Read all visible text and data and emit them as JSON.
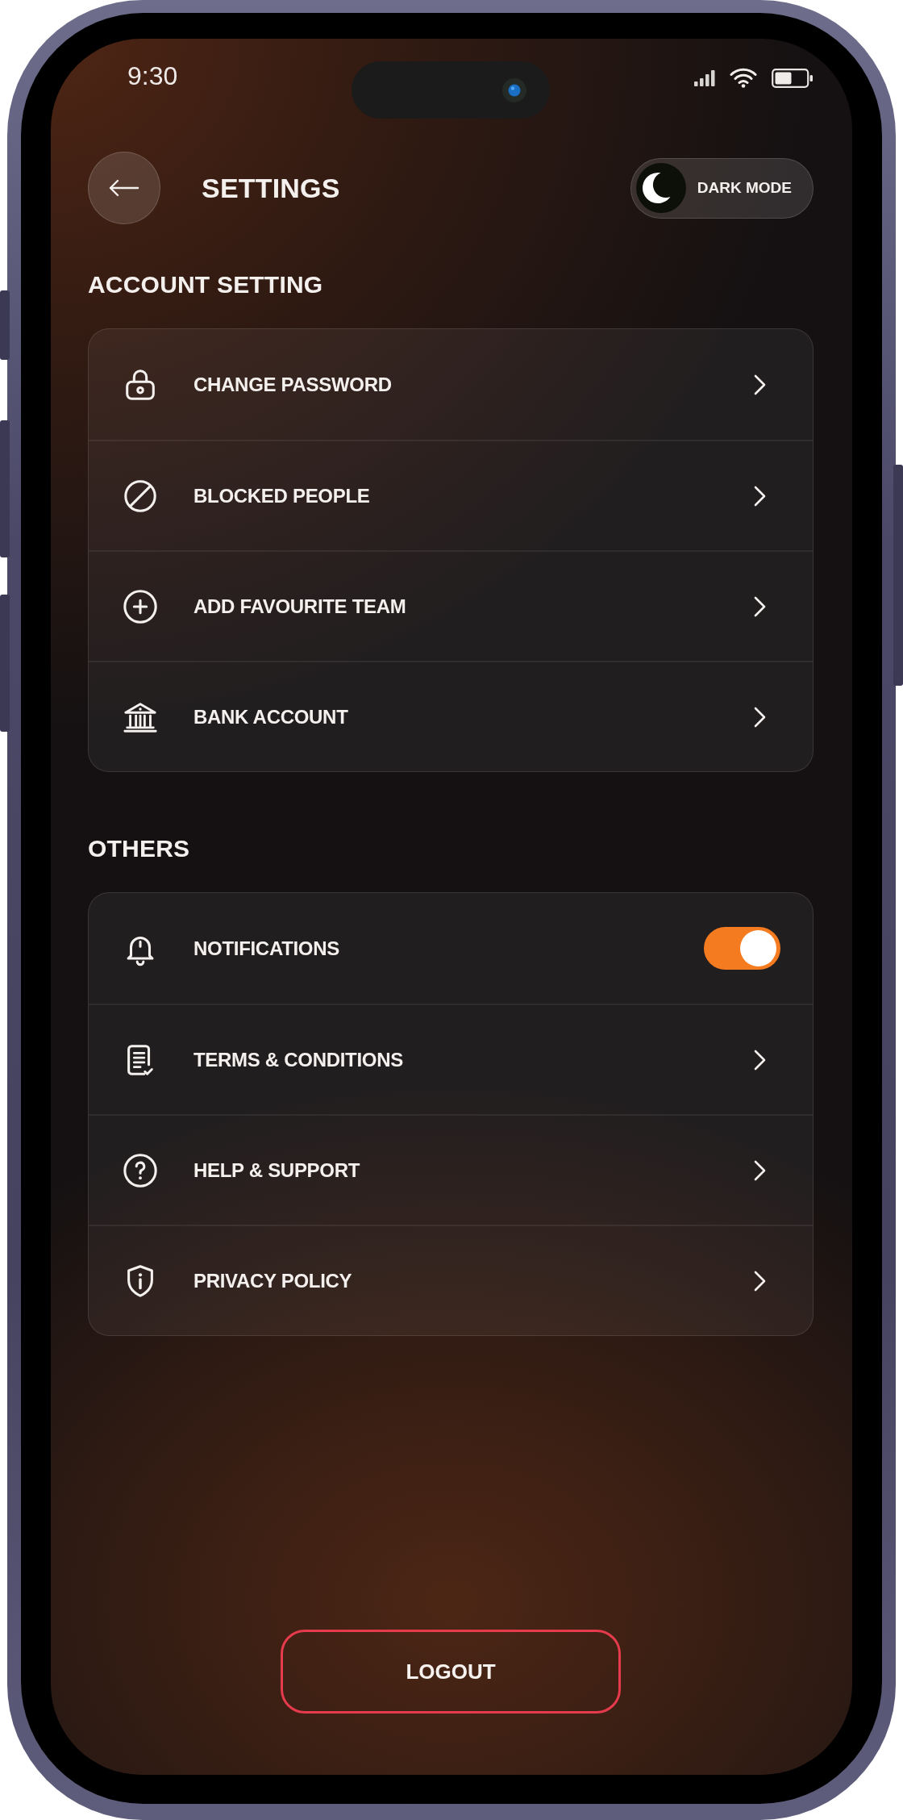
{
  "status_bar": {
    "time": "9:30"
  },
  "header": {
    "title": "SETTINGS",
    "dark_mode": {
      "label": "DARK MODE"
    }
  },
  "sections": [
    {
      "title": "ACCOUNT SETTING",
      "items": [
        {
          "label": "CHANGE PASSWORD",
          "kind": "link"
        },
        {
          "label": "BLOCKED PEOPLE",
          "kind": "link"
        },
        {
          "label": "ADD FAVOURITE TEAM",
          "kind": "link"
        },
        {
          "label": "BANK ACCOUNT",
          "kind": "link"
        }
      ]
    },
    {
      "title": "OTHERS",
      "items": [
        {
          "label": "NOTIFICATIONS",
          "kind": "toggle",
          "on": true
        },
        {
          "label": "TERMS & CONDITIONS",
          "kind": "link"
        },
        {
          "label": "HELP & SUPPORT",
          "kind": "link"
        },
        {
          "label": "PRIVACY POLICY",
          "kind": "link"
        }
      ]
    }
  ],
  "logout": {
    "label": "LOGOUT"
  }
}
